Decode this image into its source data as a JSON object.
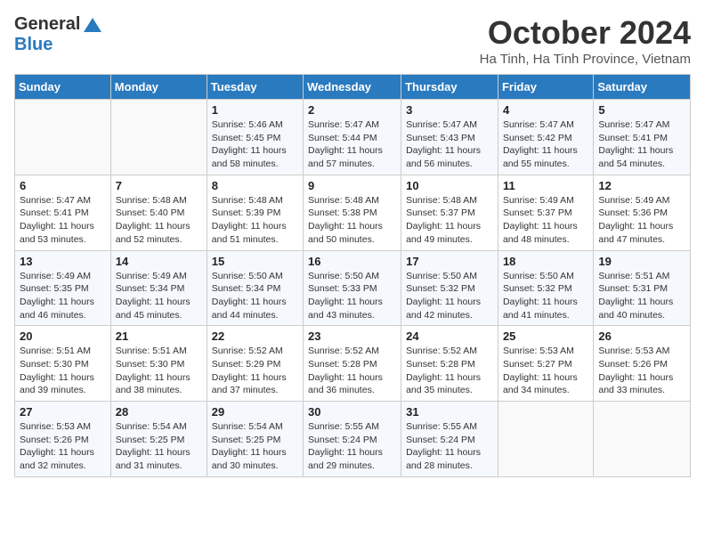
{
  "header": {
    "logo_general": "General",
    "logo_blue": "Blue",
    "month_title": "October 2024",
    "location": "Ha Tinh, Ha Tinh Province, Vietnam"
  },
  "weekdays": [
    "Sunday",
    "Monday",
    "Tuesday",
    "Wednesday",
    "Thursday",
    "Friday",
    "Saturday"
  ],
  "weeks": [
    [
      {
        "day": "",
        "info": ""
      },
      {
        "day": "",
        "info": ""
      },
      {
        "day": "1",
        "info": "Sunrise: 5:46 AM\nSunset: 5:45 PM\nDaylight: 11 hours and 58 minutes."
      },
      {
        "day": "2",
        "info": "Sunrise: 5:47 AM\nSunset: 5:44 PM\nDaylight: 11 hours and 57 minutes."
      },
      {
        "day": "3",
        "info": "Sunrise: 5:47 AM\nSunset: 5:43 PM\nDaylight: 11 hours and 56 minutes."
      },
      {
        "day": "4",
        "info": "Sunrise: 5:47 AM\nSunset: 5:42 PM\nDaylight: 11 hours and 55 minutes."
      },
      {
        "day": "5",
        "info": "Sunrise: 5:47 AM\nSunset: 5:41 PM\nDaylight: 11 hours and 54 minutes."
      }
    ],
    [
      {
        "day": "6",
        "info": "Sunrise: 5:47 AM\nSunset: 5:41 PM\nDaylight: 11 hours and 53 minutes."
      },
      {
        "day": "7",
        "info": "Sunrise: 5:48 AM\nSunset: 5:40 PM\nDaylight: 11 hours and 52 minutes."
      },
      {
        "day": "8",
        "info": "Sunrise: 5:48 AM\nSunset: 5:39 PM\nDaylight: 11 hours and 51 minutes."
      },
      {
        "day": "9",
        "info": "Sunrise: 5:48 AM\nSunset: 5:38 PM\nDaylight: 11 hours and 50 minutes."
      },
      {
        "day": "10",
        "info": "Sunrise: 5:48 AM\nSunset: 5:37 PM\nDaylight: 11 hours and 49 minutes."
      },
      {
        "day": "11",
        "info": "Sunrise: 5:49 AM\nSunset: 5:37 PM\nDaylight: 11 hours and 48 minutes."
      },
      {
        "day": "12",
        "info": "Sunrise: 5:49 AM\nSunset: 5:36 PM\nDaylight: 11 hours and 47 minutes."
      }
    ],
    [
      {
        "day": "13",
        "info": "Sunrise: 5:49 AM\nSunset: 5:35 PM\nDaylight: 11 hours and 46 minutes."
      },
      {
        "day": "14",
        "info": "Sunrise: 5:49 AM\nSunset: 5:34 PM\nDaylight: 11 hours and 45 minutes."
      },
      {
        "day": "15",
        "info": "Sunrise: 5:50 AM\nSunset: 5:34 PM\nDaylight: 11 hours and 44 minutes."
      },
      {
        "day": "16",
        "info": "Sunrise: 5:50 AM\nSunset: 5:33 PM\nDaylight: 11 hours and 43 minutes."
      },
      {
        "day": "17",
        "info": "Sunrise: 5:50 AM\nSunset: 5:32 PM\nDaylight: 11 hours and 42 minutes."
      },
      {
        "day": "18",
        "info": "Sunrise: 5:50 AM\nSunset: 5:32 PM\nDaylight: 11 hours and 41 minutes."
      },
      {
        "day": "19",
        "info": "Sunrise: 5:51 AM\nSunset: 5:31 PM\nDaylight: 11 hours and 40 minutes."
      }
    ],
    [
      {
        "day": "20",
        "info": "Sunrise: 5:51 AM\nSunset: 5:30 PM\nDaylight: 11 hours and 39 minutes."
      },
      {
        "day": "21",
        "info": "Sunrise: 5:51 AM\nSunset: 5:30 PM\nDaylight: 11 hours and 38 minutes."
      },
      {
        "day": "22",
        "info": "Sunrise: 5:52 AM\nSunset: 5:29 PM\nDaylight: 11 hours and 37 minutes."
      },
      {
        "day": "23",
        "info": "Sunrise: 5:52 AM\nSunset: 5:28 PM\nDaylight: 11 hours and 36 minutes."
      },
      {
        "day": "24",
        "info": "Sunrise: 5:52 AM\nSunset: 5:28 PM\nDaylight: 11 hours and 35 minutes."
      },
      {
        "day": "25",
        "info": "Sunrise: 5:53 AM\nSunset: 5:27 PM\nDaylight: 11 hours and 34 minutes."
      },
      {
        "day": "26",
        "info": "Sunrise: 5:53 AM\nSunset: 5:26 PM\nDaylight: 11 hours and 33 minutes."
      }
    ],
    [
      {
        "day": "27",
        "info": "Sunrise: 5:53 AM\nSunset: 5:26 PM\nDaylight: 11 hours and 32 minutes."
      },
      {
        "day": "28",
        "info": "Sunrise: 5:54 AM\nSunset: 5:25 PM\nDaylight: 11 hours and 31 minutes."
      },
      {
        "day": "29",
        "info": "Sunrise: 5:54 AM\nSunset: 5:25 PM\nDaylight: 11 hours and 30 minutes."
      },
      {
        "day": "30",
        "info": "Sunrise: 5:55 AM\nSunset: 5:24 PM\nDaylight: 11 hours and 29 minutes."
      },
      {
        "day": "31",
        "info": "Sunrise: 5:55 AM\nSunset: 5:24 PM\nDaylight: 11 hours and 28 minutes."
      },
      {
        "day": "",
        "info": ""
      },
      {
        "day": "",
        "info": ""
      }
    ]
  ]
}
